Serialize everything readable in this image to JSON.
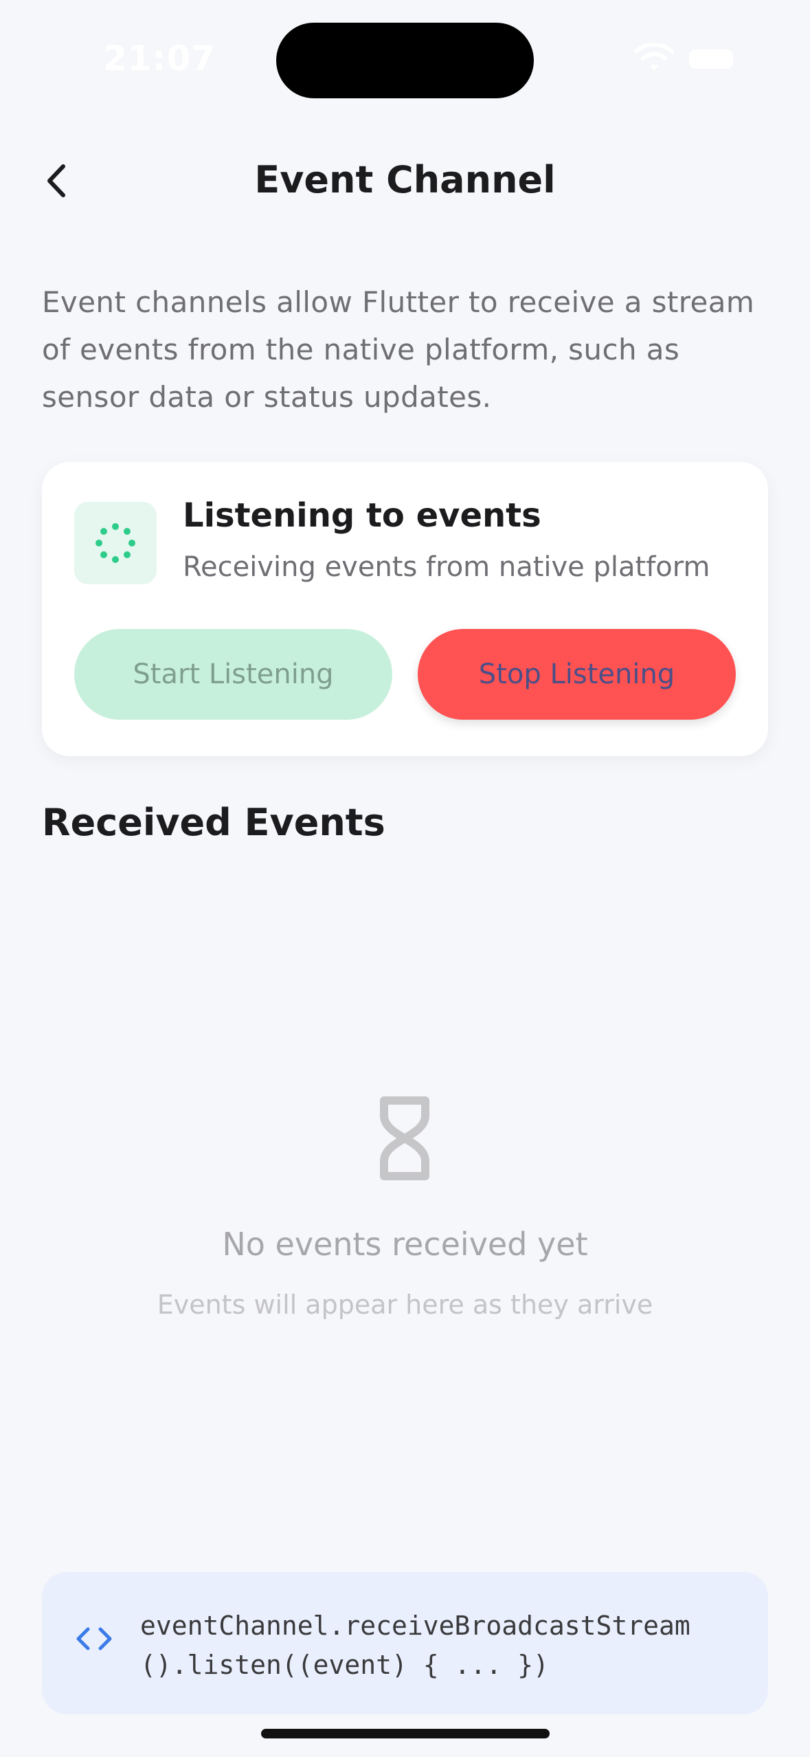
{
  "status_bar": {
    "time": "21:07"
  },
  "nav": {
    "title": "Event Channel",
    "back_icon": "chevron-left-icon"
  },
  "description": "Event channels allow Flutter to receive a stream of events from the native platform, such as sensor data or status updates.",
  "status_card": {
    "icon": "loading-dots-icon",
    "title": "Listening to events",
    "subtitle": "Receiving events from native platform",
    "start_label": "Start Listening",
    "stop_label": "Stop Listening"
  },
  "events": {
    "section_title": "Received Events",
    "empty_icon": "hourglass-icon",
    "empty_title": "No events received yet",
    "empty_subtitle": "Events will appear here as they arrive"
  },
  "code": {
    "icon": "code-icon",
    "line1": "eventChannel.receiveBroadcastStream",
    "line2": "().listen((event) { ... })"
  },
  "colors": {
    "accent_green": "#2ecc8a",
    "start_button_bg": "#c7f0dc",
    "stop_button_bg": "#ff5252",
    "code_bg": "#e9effd",
    "code_icon": "#3b7be8"
  }
}
